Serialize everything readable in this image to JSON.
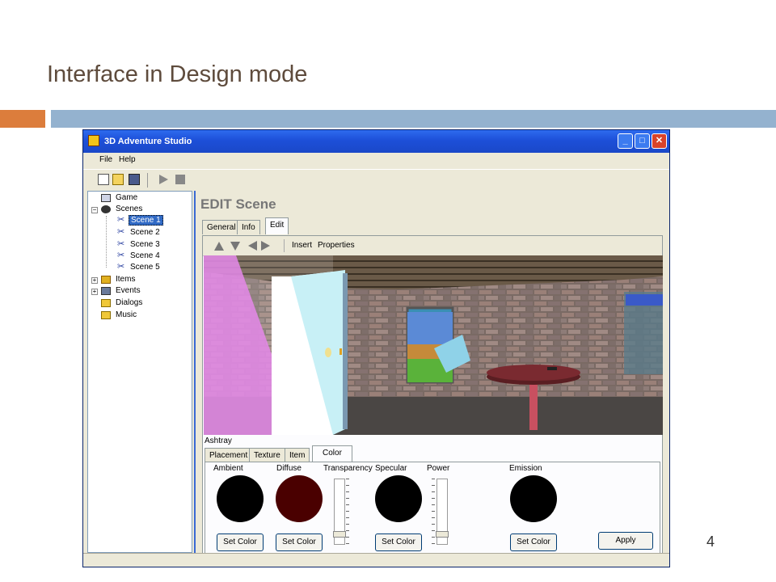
{
  "slide": {
    "title": "Interface in Design mode",
    "page_number": "4"
  },
  "window": {
    "title": "3D Adventure Studio"
  },
  "menu": [
    "File",
    "Help"
  ],
  "toolbar": {
    "icons": [
      "new-file-icon",
      "open-folder-icon",
      "save-disk-icon",
      "play-icon",
      "stop-icon"
    ]
  },
  "tree": {
    "game": "Game",
    "scenes": "Scenes",
    "scene_items": [
      "Scene 1",
      "Scene 2",
      "Scene 3",
      "Scene 4",
      "Scene 5"
    ],
    "selected": "Scene 1",
    "items": "Items",
    "events": "Events",
    "dialogs": "Dialogs",
    "music": "Music"
  },
  "edit": {
    "heading": "EDIT Scene",
    "tabs": [
      "General",
      "Info",
      "Edit"
    ],
    "active_tab": "Edit",
    "nav_links": [
      "Insert",
      "Properties"
    ],
    "object_name": "Ashtray",
    "subtabs": [
      "Placement",
      "Texture",
      "Item",
      "Color"
    ],
    "active_subtab": "Color"
  },
  "color_panel": {
    "labels": [
      "Ambient",
      "Diffuse",
      "Transparency",
      "Specular",
      "Power",
      "Emission"
    ],
    "swatches": {
      "ambient": "#000000",
      "diffuse": "#4a0000",
      "specular": "#000000",
      "emission": "#000000"
    },
    "set_color": "Set Color",
    "apply": "Apply"
  },
  "colors": {
    "titlebar": "#1d4fd8",
    "slide_orange": "#dc7d3c",
    "slide_blue": "#94b2cf",
    "title_text": "#5e4b3c"
  }
}
